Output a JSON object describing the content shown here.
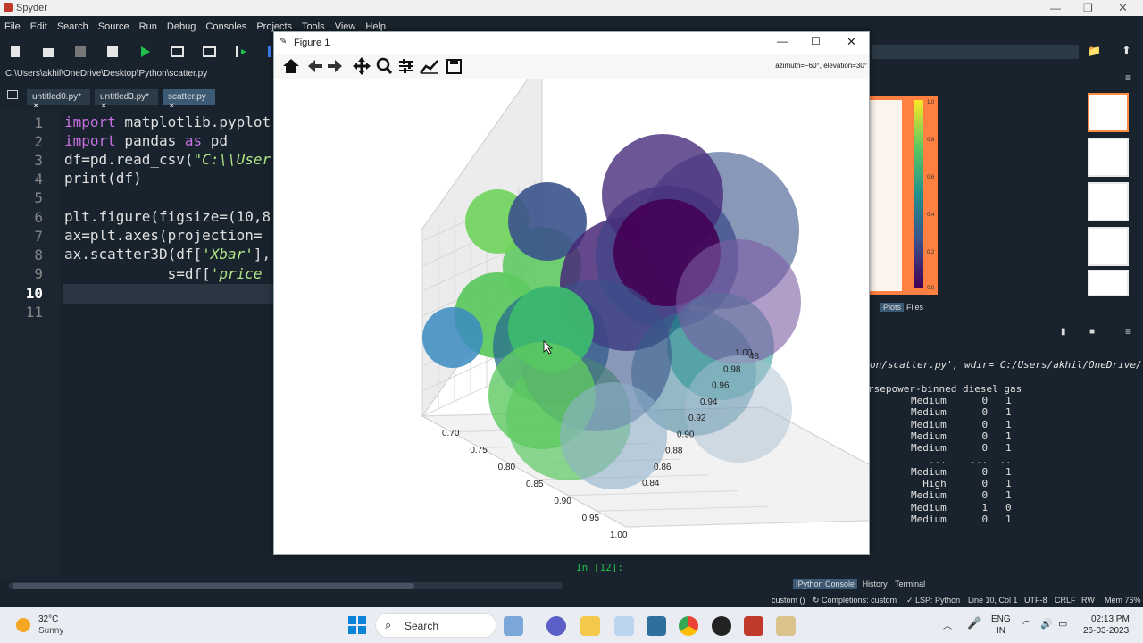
{
  "app": {
    "title": "Spyder"
  },
  "menu": [
    "File",
    "Edit",
    "Search",
    "Source",
    "Run",
    "Debug",
    "Consoles",
    "Projects",
    "Tools",
    "View",
    "Help"
  ],
  "path": "C:\\Users\\akhil\\OneDrive\\Desktop\\Python\\scatter.py",
  "tabs": [
    "untitled0.py*",
    "untitled3.py*",
    "scatter.py"
  ],
  "editor": {
    "line_numbers": [
      "1",
      "2",
      "3",
      "4",
      "5",
      "6",
      "7",
      "8",
      "9",
      "10",
      "11"
    ],
    "lines": [
      {
        "kw": "import",
        "rest": " matplotlib.pyplot"
      },
      {
        "kw": "import",
        "mid": " pandas ",
        "kw2": "as",
        "rest": " pd"
      },
      {
        "pre": "df=pd.read_csv(",
        "str": "\"C:\\\\User"
      },
      {
        "pre": "print(df)"
      },
      {
        "pre": ""
      },
      {
        "pre": "plt.figure(figsize=(10,8"
      },
      {
        "pre": "ax=plt.axes(projection="
      },
      {
        "pre": "ax.scatter3D(df[",
        "str": "'Xbar'",
        "rest": "],"
      },
      {
        "pre": "            s=df[",
        "str": "'price"
      },
      {
        "pre": ""
      },
      {
        "pre": ""
      }
    ]
  },
  "figure": {
    "title": "Figure 1",
    "azimuth_text": "azimuth=−60°, elevation=30°",
    "buttons": [
      "home-icon",
      "back-icon",
      "forward-icon",
      "pan-icon",
      "zoom-icon",
      "configure-icon",
      "edit-axis-icon",
      "save-icon"
    ]
  },
  "chart_data": {
    "type": "scatter",
    "xlim": [
      0.7,
      1.0
    ],
    "ylim": [
      0.84,
      1.0
    ],
    "x_ticks": [
      "0.70",
      "0.75",
      "0.80",
      "0.85",
      "0.90",
      "0.95",
      "1.00"
    ],
    "y_ticks": [
      "0.84",
      "0.86",
      "0.88",
      "0.90",
      "0.92",
      "0.94",
      "0.96",
      "0.98",
      "1.00"
    ],
    "z_ticks_visible": [
      "48"
    ],
    "colormap": "viridis"
  },
  "plots_pane": {
    "tabs": [
      "Plots",
      "Files"
    ],
    "colorbar_ticks": [
      "1.0",
      "0.8",
      "0.6",
      "0.4",
      "0.2",
      "0.0"
    ]
  },
  "console": {
    "run_line": "on/scatter.py', wdir='C:/Users/akhil/OneDrive/",
    "header": "rsepower-binned diesel gas",
    "rows": [
      [
        "Medium",
        "0",
        "1"
      ],
      [
        "Medium",
        "0",
        "1"
      ],
      [
        "Medium",
        "0",
        "1"
      ],
      [
        "Medium",
        "0",
        "1"
      ],
      [
        "Medium",
        "0",
        "1"
      ],
      [
        "...",
        "...",
        ".."
      ],
      [
        "Medium",
        "0",
        "1"
      ],
      [
        "High",
        "0",
        "1"
      ],
      [
        "Medium",
        "0",
        "1"
      ],
      [
        "Medium",
        "1",
        "0"
      ],
      [
        "Medium",
        "0",
        "1"
      ]
    ],
    "prompt": "In [12]:",
    "tabs": [
      "IPython Console",
      "History",
      "Terminal"
    ]
  },
  "status": {
    "items": [
      "custom ()",
      "Completions: custom",
      "LSP: Python",
      "Line 10, Col 1",
      "UTF-8",
      "CRLF",
      "RW",
      "Mem 76%"
    ]
  },
  "taskbar": {
    "weather_temp": "32°C",
    "weather_desc": "Sunny",
    "search": "Search",
    "lang1": "ENG",
    "lang2": "IN",
    "time": "02:13 PM",
    "date": "26-03-2023"
  }
}
